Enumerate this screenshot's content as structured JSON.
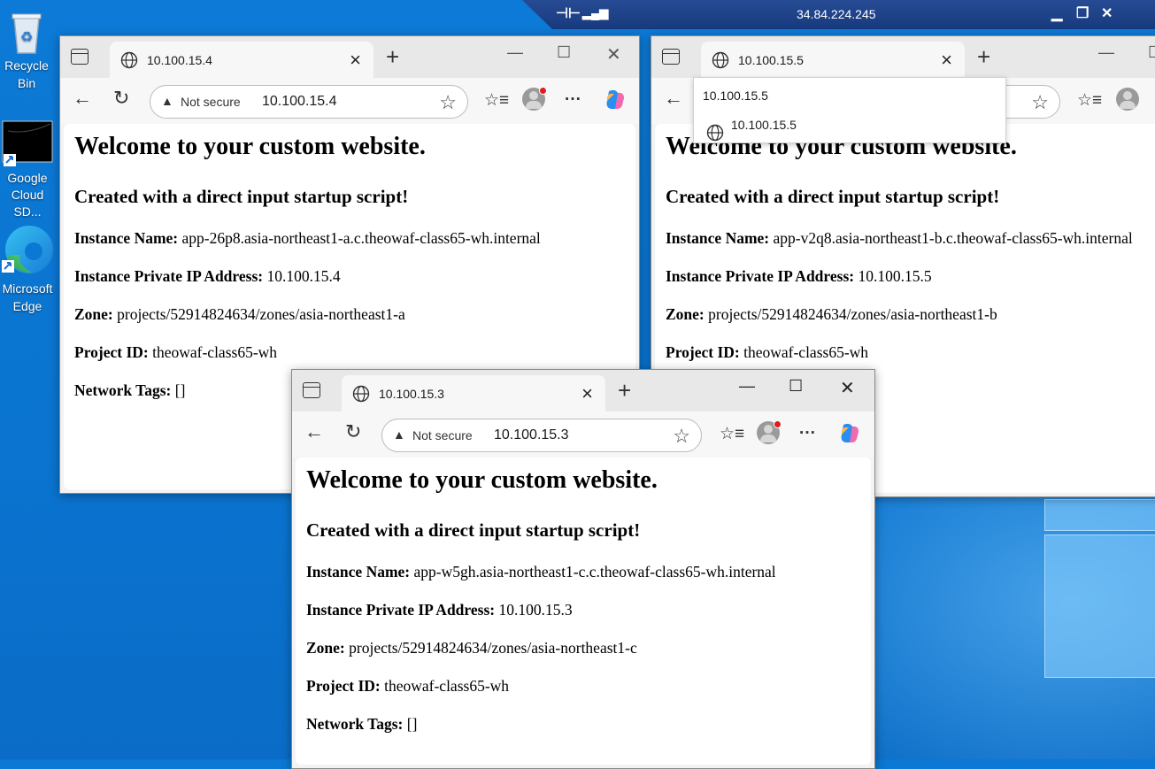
{
  "rdp": {
    "ip": "34.84.224.245"
  },
  "desktop_icons": [
    {
      "label": "Recycle Bin"
    },
    {
      "label": "Google Cloud SD..."
    },
    {
      "label": "Microsoft Edge"
    }
  ],
  "windows": {
    "w1": {
      "tab_title": "10.100.15.4",
      "not_secure": "Not secure",
      "url": "10.100.15.4",
      "page": {
        "heading": "Welcome to your custom website.",
        "subheading": "Created with a direct input startup script!",
        "instance_name_label": "Instance Name:",
        "instance_name": "app-26p8.asia-northeast1-a.c.theowaf-class65-wh.internal",
        "ip_label": "Instance Private IP Address:",
        "ip": "10.100.15.4",
        "zone_label": "Zone:",
        "zone": "projects/52914824634/zones/asia-northeast1-a",
        "project_label": "Project ID:",
        "project": "theowaf-class65-wh",
        "tags_label": "Network Tags:",
        "tags": "[]"
      }
    },
    "w2": {
      "tab_title": "10.100.15.5",
      "dropdown_text": "10.100.15.5",
      "dropdown_suggestion": "10.100.15.5",
      "page": {
        "heading": "Welcome to your custom website.",
        "subheading": "Created with a direct input startup script!",
        "instance_name_label": "Instance Name:",
        "instance_name": "app-v2q8.asia-northeast1-b.c.theowaf-class65-wh.internal",
        "ip_label": "Instance Private IP Address:",
        "ip": "10.100.15.5",
        "zone_label": "Zone:",
        "zone": "projects/52914824634/zones/asia-northeast1-b",
        "project_label": "Project ID:",
        "project": "theowaf-class65-wh"
      }
    },
    "w3": {
      "tab_title": "10.100.15.3",
      "not_secure": "Not secure",
      "url": "10.100.15.3",
      "page": {
        "heading": "Welcome to your custom website.",
        "subheading": "Created with a direct input startup script!",
        "instance_name_label": "Instance Name:",
        "instance_name": "app-w5gh.asia-northeast1-c.c.theowaf-class65-wh.internal",
        "ip_label": "Instance Private IP Address:",
        "ip": "10.100.15.3",
        "zone_label": "Zone:",
        "zone": "projects/52914824634/zones/asia-northeast1-c",
        "project_label": "Project ID:",
        "project": "theowaf-class65-wh",
        "tags_label": "Network Tags:",
        "tags": "[]"
      }
    }
  },
  "icons": {
    "tab_actions": "tab-actions-icon",
    "globe": "globe-icon",
    "back": "back-arrow-icon",
    "refresh": "refresh-icon",
    "favorites": "favorites-icon",
    "more": "more-icon",
    "copilot": "copilot-icon",
    "warning": "warning-icon"
  },
  "colors": {
    "desktop": "#0a78d4",
    "rdp_bar": "#1f428a",
    "notification_dot": "#e01b1b"
  }
}
